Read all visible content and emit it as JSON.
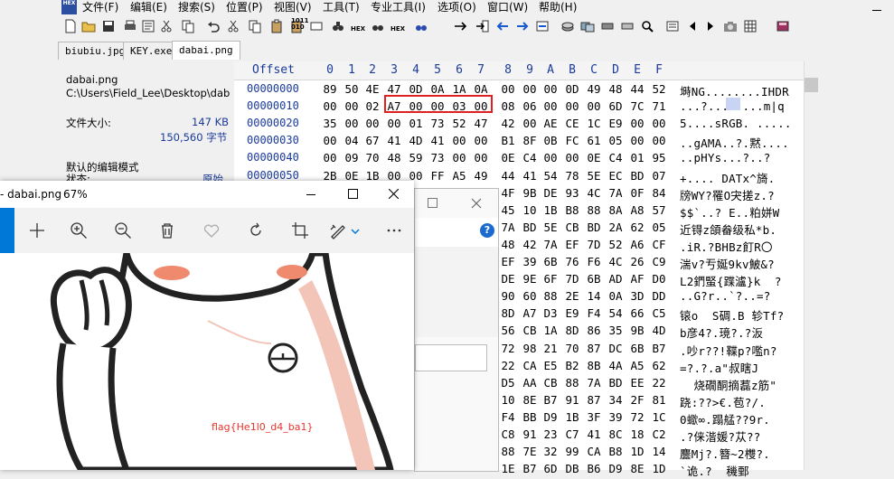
{
  "menu": [
    "文件(F)",
    "编辑(E)",
    "搜索(S)",
    "位置(P)",
    "视图(V)",
    "工具(T)",
    "专业工具(I)",
    "选项(O)",
    "窗口(W)",
    "帮助(H)"
  ],
  "app_logo_text": "HEX",
  "toolbar": {
    "hex_label": "HEX",
    "bin_label": "1011\n010"
  },
  "tabs": [
    "biubiu.jpg",
    "KEY.exe",
    "dabai.png"
  ],
  "info": {
    "filename": "dabai.png",
    "path": "C:\\Users\\Field_Lee\\Desktop\\dab",
    "size_label": "文件大小:",
    "size_kb": "147 KB",
    "size_bytes": "150,560 字节",
    "mode_label": "默认的编辑模式",
    "state_label": "状态:",
    "state_value": "原始"
  },
  "hex": {
    "offset_header": "Offset",
    "col_headers": [
      "0",
      "1",
      "2",
      "3",
      "4",
      "5",
      "6",
      "7",
      "8",
      "9",
      "A",
      "B",
      "C",
      "D",
      "E",
      "F"
    ],
    "rows": [
      {
        "off": "00000000",
        "bytes": [
          "89",
          "50",
          "4E",
          "47",
          "0D",
          "0A",
          "1A",
          "0A",
          "00",
          "00",
          "00",
          "0D",
          "49",
          "48",
          "44",
          "52"
        ],
        "ascii": "塒NG........IHDR"
      },
      {
        "off": "00000010",
        "bytes": [
          "00",
          "00",
          "02",
          "A7",
          "00",
          "00",
          "03",
          "00",
          "08",
          "06",
          "00",
          "00",
          "00",
          "6D",
          "7C",
          "71"
        ],
        "ascii": "...?........m|q"
      },
      {
        "off": "00000020",
        "bytes": [
          "35",
          "00",
          "00",
          "00",
          "01",
          "73",
          "52",
          "47",
          "42",
          "00",
          "AE",
          "CE",
          "1C",
          "E9",
          "00",
          "00"
        ],
        "ascii": "5....sRGB. ....."
      },
      {
        "off": "00000030",
        "bytes": [
          "00",
          "04",
          "67",
          "41",
          "4D",
          "41",
          "00",
          "00",
          "B1",
          "8F",
          "0B",
          "FC",
          "61",
          "05",
          "00",
          "00"
        ],
        "ascii": "..gAMA..?.黙...."
      },
      {
        "off": "00000040",
        "bytes": [
          "00",
          "09",
          "70",
          "48",
          "59",
          "73",
          "00",
          "00",
          "0E",
          "C4",
          "00",
          "00",
          "0E",
          "C4",
          "01",
          "95"
        ],
        "ascii": "..pHYs...?..?"
      },
      {
        "off": "00000050",
        "bytes": [
          "2B",
          "0E",
          "1B",
          "00",
          "00",
          "FF",
          "A5",
          "49",
          "44",
          "41",
          "54",
          "78",
          "5E",
          "EC",
          "BD",
          "07"
        ],
        "ascii": "+.... DATx^旖."
      },
      {
        "off": "",
        "bytes": [
          "",
          "",
          "",
          "",
          "",
          "",
          "",
          "",
          "4F",
          "9B",
          "DE",
          "93",
          "4C",
          "7A",
          "0F",
          "84"
        ],
        "ascii": "牓WY?罹O宊搓z.?"
      },
      {
        "off": "",
        "bytes": [
          "",
          "",
          "",
          "",
          "",
          "",
          "",
          "",
          "45",
          "10",
          "1B",
          "B8",
          "88",
          "8A",
          "A8",
          "57"
        ],
        "ascii": "$$`..? E..粕姘W"
      },
      {
        "off": "",
        "bytes": [
          "",
          "",
          "",
          "",
          "",
          "",
          "",
          "",
          "7A",
          "BD",
          "5E",
          "CB",
          "BD",
          "2A",
          "62",
          "05"
        ],
        "ascii": "近锝z頜畚级私*b."
      },
      {
        "off": "",
        "bytes": [
          "",
          "",
          "",
          "",
          "",
          "",
          "",
          "",
          "48",
          "42",
          "7A",
          "EF",
          "7D",
          "52",
          "A6",
          "CF"
        ],
        "ascii": ".iR.?BHBz飣R〇"
      },
      {
        "off": "",
        "bytes": [
          "",
          "",
          "",
          "",
          "",
          "",
          "",
          "",
          "EF",
          "39",
          "6B",
          "76",
          "F6",
          "4C",
          "26",
          "C9"
        ],
        "ascii": "湍v?亐娫9kv鮍&?"
      },
      {
        "off": "",
        "bytes": [
          "",
          "",
          "",
          "",
          "",
          "",
          "",
          "",
          "DE",
          "9E",
          "6F",
          "7D",
          "6B",
          "AD",
          "AF",
          "D0"
        ],
        "ascii": "L2鍆蜸{蹀瀘}k  ?"
      },
      {
        "off": "",
        "bytes": [
          "",
          "",
          "",
          "",
          "",
          "",
          "",
          "",
          "90",
          "60",
          "88",
          "2E",
          "14",
          "0A",
          "3D",
          "DD"
        ],
        "ascii": "..G?r..`?..=?"
      },
      {
        "off": "",
        "bytes": [
          "",
          "",
          "",
          "",
          "",
          "",
          "",
          "",
          "8D",
          "A7",
          "D3",
          "E9",
          "F4",
          "54",
          "66",
          "C5"
        ],
        "ascii": "锿o  S碉.B 轸Tf?"
      },
      {
        "off": "",
        "bytes": [
          "",
          "",
          "",
          "",
          "",
          "",
          "",
          "",
          "56",
          "CB",
          "1A",
          "8D",
          "86",
          "35",
          "9B",
          "4D"
        ],
        "ascii": "b彦4?.璄?.?汳"
      },
      {
        "off": "",
        "bytes": [
          "",
          "",
          "",
          "",
          "",
          "",
          "",
          "",
          "72",
          "98",
          "21",
          "70",
          "87",
          "DC",
          "6B",
          "B7"
        ],
        "ascii": ".吵r??!鞢p?嚂n?"
      },
      {
        "off": "",
        "bytes": [
          "",
          "",
          "",
          "",
          "",
          "",
          "",
          "",
          "22",
          "CA",
          "E5",
          "B2",
          "8B",
          "4A",
          "A5",
          "62"
        ],
        "ascii": "=?.?.a\"叔瞎J"
      },
      {
        "off": "",
        "bytes": [
          "",
          "",
          "",
          "",
          "",
          "",
          "",
          "",
          "D5",
          "AA",
          "CB",
          "88",
          "7A",
          "BD",
          "EE",
          "22"
        ],
        "ascii": "  烧礀酮摘藞z筋\""
      },
      {
        "off": "",
        "bytes": [
          "",
          "",
          "",
          "",
          "",
          "",
          "",
          "",
          "10",
          "8E",
          "B7",
          "91",
          "87",
          "34",
          "2F",
          "81"
        ],
        "ascii": "跷:??>€.苞?/."
      },
      {
        "off": "",
        "bytes": [
          "",
          "",
          "",
          "",
          "",
          "",
          "",
          "",
          "F4",
          "BB",
          "D9",
          "1B",
          "3F",
          "39",
          "72",
          "1C"
        ],
        "ascii": "0蠍∞.蹋艋??9r."
      },
      {
        "off": "",
        "bytes": [
          "",
          "",
          "",
          "",
          "",
          "",
          "",
          "",
          "C8",
          "91",
          "23",
          "C7",
          "41",
          "8C",
          "18",
          "C2"
        ],
        "ascii": ".?俫湝媛?苁??"
      },
      {
        "off": "",
        "bytes": [
          "",
          "",
          "",
          "",
          "",
          "",
          "",
          "",
          "88",
          "7E",
          "32",
          "99",
          "CA",
          "B8",
          "1D",
          "14"
        ],
        "ascii": "麢Mj?.簪~2欆?."
      },
      {
        "off": "",
        "bytes": [
          "",
          "",
          "",
          "",
          "",
          "",
          "",
          "",
          "1E",
          "B7",
          "6D",
          "DB",
          "B6",
          "D9",
          "8E",
          "1D"
        ],
        "ascii": "`诡.?  穖鄄"
      }
    ]
  },
  "photos": {
    "title": "- dabai.png",
    "zoom": "67%",
    "flag_text": "flag{He1l0_d4_ba1}"
  },
  "colors": {
    "selection_box": "#e02020",
    "hex_blue": "#1a3a9a",
    "flag_red": "#e8322a",
    "photos_accent": "#0078d7"
  }
}
